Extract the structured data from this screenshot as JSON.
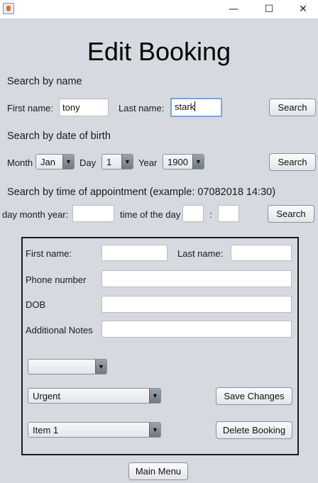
{
  "window": {
    "minimize_glyph": "—",
    "maximize_glyph": "☐",
    "close_glyph": "✕"
  },
  "page": {
    "title": "Edit Booking"
  },
  "search_name": {
    "heading": "Search by name",
    "first_label": "First name:",
    "first_value": "tony",
    "last_label": "Last name:",
    "last_value": "stark",
    "button": "Search"
  },
  "search_dob": {
    "heading": "Search by date of birth",
    "month_label": "Month",
    "month_value": "Jan",
    "day_label": "Day",
    "day_value": "1",
    "year_label": "Year",
    "year_value": "1900",
    "button": "Search"
  },
  "search_time": {
    "heading": "Search by time of appointment (example: 07082018 14:30)",
    "date_label": "day month year:",
    "date_value": "",
    "time_label": "time of the day",
    "hour_value": "",
    "colon": ":",
    "minute_value": "",
    "button": "Search"
  },
  "details": {
    "first_label": "First name:",
    "first_value": "",
    "last_label": "Last name:",
    "last_value": "",
    "phone_label": "Phone number",
    "phone_value": "",
    "dob_label": "DOB",
    "dob_value": "",
    "notes_label": "Additional Notes",
    "notes_value": "",
    "blank_combo_value": "",
    "priority_value": "Urgent",
    "item_value": "Item 1",
    "save_button": "Save Changes",
    "delete_button": "Delete Booking"
  },
  "footer": {
    "main_menu_button": "Main Menu"
  },
  "icons": {
    "combo_arrow": "▼"
  },
  "colors": {
    "background": "#d6d9df",
    "focus_border": "#7aa6d6"
  }
}
